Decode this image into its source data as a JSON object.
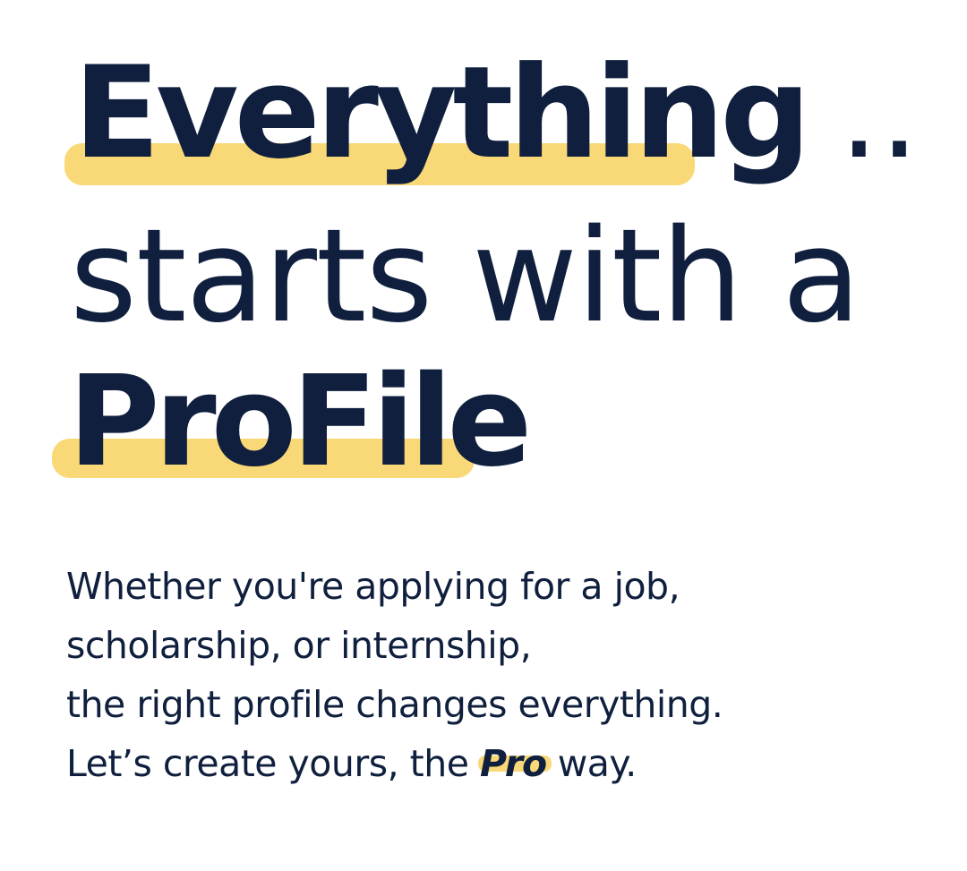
{
  "headline": {
    "word1": "Everything",
    "dots": "..",
    "line2": "starts with a",
    "word3": "ProFile"
  },
  "body": {
    "line1": "Whether you're applying for a job,",
    "line2": "scholarship, or internship,",
    "line3": "the right profile changes everything.",
    "line4_before": "Let’s create yours, the",
    "pro": "Pro",
    "line4_after": "way."
  },
  "colors": {
    "text": "#0f1f3d",
    "highlight": "#f8d877",
    "background": "#ffffff"
  }
}
